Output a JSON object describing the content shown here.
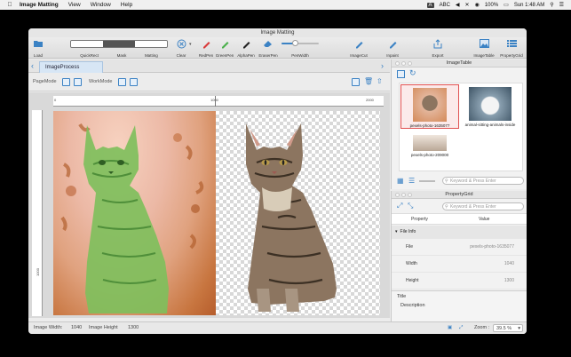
{
  "menubar": {
    "items": [
      "Image Matting",
      "View",
      "Window",
      "Help"
    ],
    "status_abc": "ABC",
    "battery": "100%",
    "clock": "Sun 1:48 AM"
  },
  "window": {
    "title": "Image Matting"
  },
  "toolbar": {
    "load": "Load",
    "quickrect": "QuickRect",
    "mask": "Mask",
    "matting": "Matting",
    "clear": "Clear",
    "redpen": "RedPen",
    "greenpen": "GreenPen",
    "alphapen": "AlphaPen",
    "eraserpen": "EraserPen",
    "penwidth": "PenWidth",
    "penwidth_level": 0.35,
    "imagecut": "ImageCut",
    "inpaint": "Inpaint",
    "export": "Export",
    "imagetable": "ImageTable",
    "propertygrid": "PropertyGrid"
  },
  "tabs": {
    "active": "ImageProcess"
  },
  "modebar": {
    "pagemode": "PageMode",
    "workmode": "WorkMode"
  },
  "ruler": {
    "top_start": "0",
    "top_mid": "1000",
    "top_end": "2000",
    "left_mark": "1000"
  },
  "status": {
    "width_label": "Image Width:",
    "width_value": "1040",
    "height_label": "Image Height",
    "height_value": "1300",
    "zoom_label": "Zoom :",
    "zoom_value": "39.5 %"
  },
  "imagetable": {
    "title": "ImageTable",
    "thumbs": [
      "pexels-photo-1635077",
      "animal-sitting-animals-inside",
      "pexels-photo-209000"
    ],
    "search_placeholder": "Keyword & Press Enter"
  },
  "propertygrid": {
    "title": "PropertyGrid",
    "search_placeholder": "Keyword & Press Enter",
    "col_property": "Property",
    "col_value": "Value",
    "group": "File Info",
    "rows": [
      {
        "key": "File",
        "value": "pexels-photo-1635077"
      },
      {
        "key": "Width",
        "value": "1040"
      },
      {
        "key": "Height",
        "value": "1300"
      }
    ],
    "footer_title": "Title",
    "footer_desc": "Description"
  },
  "colors": {
    "accent": "#3b82c4",
    "red_pen": "#d93a3a",
    "green_pen": "#49b04a"
  }
}
